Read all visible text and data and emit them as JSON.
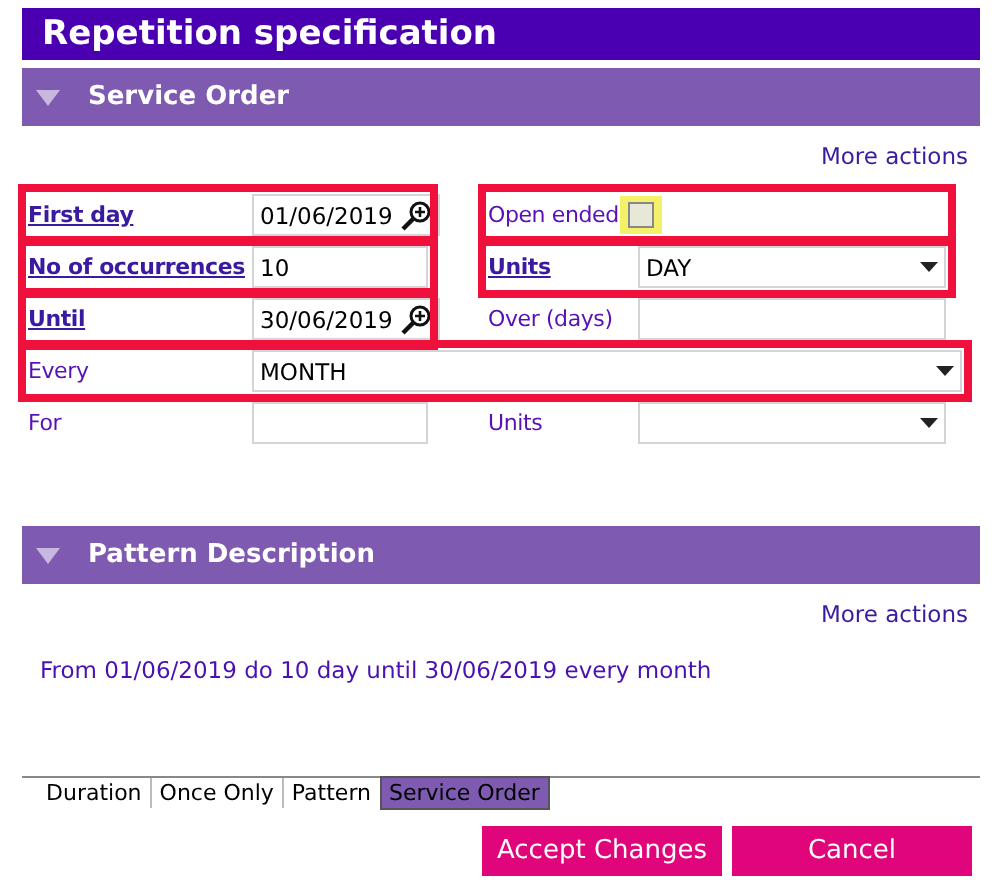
{
  "window": {
    "title": "Repetition specification"
  },
  "sections": [
    {
      "title": "Service Order",
      "expanded": true,
      "more_actions": "More actions"
    },
    {
      "title": "Pattern Description",
      "expanded": true,
      "more_actions": "More actions",
      "text": "From 01/06/2019 do 10 day until 30/06/2019 every month"
    }
  ],
  "rows": [
    {
      "fields": [
        {
          "label": "First day",
          "link": true,
          "kind": "date",
          "value": "01/06/2019",
          "highlighted": true
        },
        {
          "label": "Open ended",
          "link": false,
          "kind": "checkbox",
          "checked": false,
          "marked": true,
          "highlighted": true
        }
      ]
    },
    {
      "fields": [
        {
          "label": "No of occurrences",
          "link": true,
          "kind": "text",
          "value": "10",
          "highlighted": true
        },
        {
          "label": "Units",
          "link": true,
          "kind": "select",
          "value": "DAY",
          "highlighted": true
        }
      ]
    },
    {
      "fields": [
        {
          "label": "Until",
          "link": true,
          "kind": "date",
          "value": "30/06/2019",
          "highlighted": true
        },
        {
          "label": "Over (days)",
          "link": false,
          "kind": "text",
          "highlighted": false
        }
      ]
    },
    {
      "fields": [
        {
          "label": "Every",
          "link": false,
          "kind": "wideselect",
          "value": "MONTH",
          "highlighted": true
        }
      ]
    },
    {
      "fields": [
        {
          "label": "For",
          "link": false,
          "kind": "text",
          "highlighted": false
        },
        {
          "label": "Units",
          "link": false,
          "kind": "select",
          "highlighted": false
        }
      ]
    }
  ],
  "tabs": [
    {
      "label": "Duration",
      "selected": false
    },
    {
      "label": "Once Only",
      "selected": false
    },
    {
      "label": "Pattern",
      "selected": false
    },
    {
      "label": "Service Order",
      "selected": true
    }
  ],
  "buttons": [
    "Accept Changes",
    "Cancel"
  ]
}
